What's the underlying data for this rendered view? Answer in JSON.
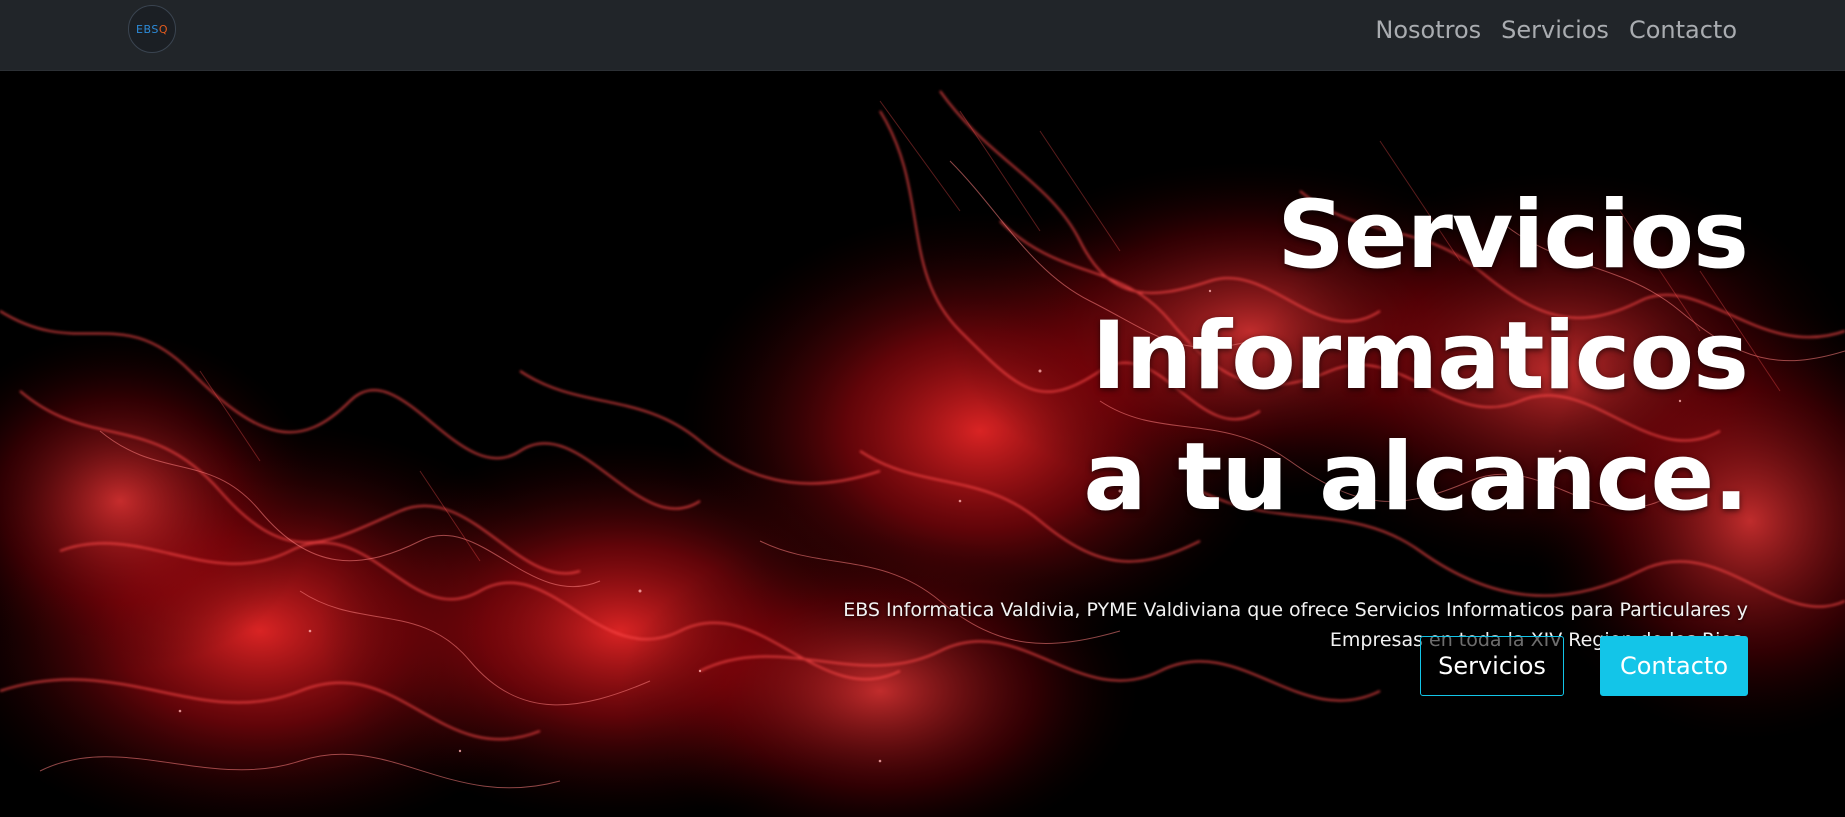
{
  "navbar": {
    "logo": {
      "text_a": "EBS",
      "text_b": "Q"
    },
    "links": [
      "Nosotros",
      "Servicios",
      "Contacto"
    ]
  },
  "hero": {
    "headline": [
      "Servicios",
      "Informaticos",
      "a tu alcance."
    ],
    "subtitle_line1": "EBS Informatica Valdivia, PYME Valdiviana que ofrece Servicios Informaticos para Particulares y",
    "subtitle_line2": "Empresas en toda la XIV Region de los Rios.",
    "buttons": {
      "secondary": "Servicios",
      "primary": "Contacto"
    }
  },
  "colors": {
    "navbar_bg": "#212529",
    "accent": "#13c5e8",
    "background_art": "#d4121a"
  },
  "icons": {
    "logo": "ebs-logo-icon"
  }
}
